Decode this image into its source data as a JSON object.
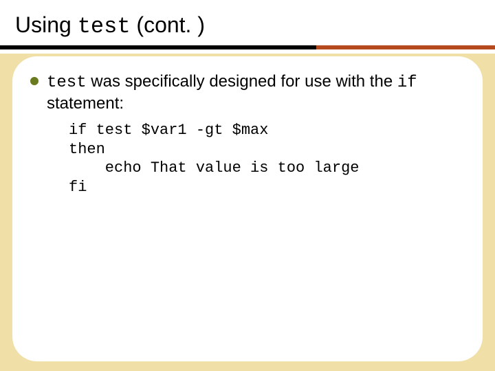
{
  "title": {
    "pre": "Using ",
    "code": "test",
    "post": " (cont. )"
  },
  "bullet": {
    "code1": "test",
    "mid": " was specifically designed for use with the ",
    "code2": "if",
    "tail": " statement:"
  },
  "code": {
    "l1": "if test $var1 -gt $max",
    "l2": "then",
    "l3": "    echo That value is too large",
    "l4": "fi"
  },
  "colors": {
    "accent": "#b44a1e",
    "bullet": "#6a7a1f",
    "body_bg": "#f0e0a8"
  }
}
